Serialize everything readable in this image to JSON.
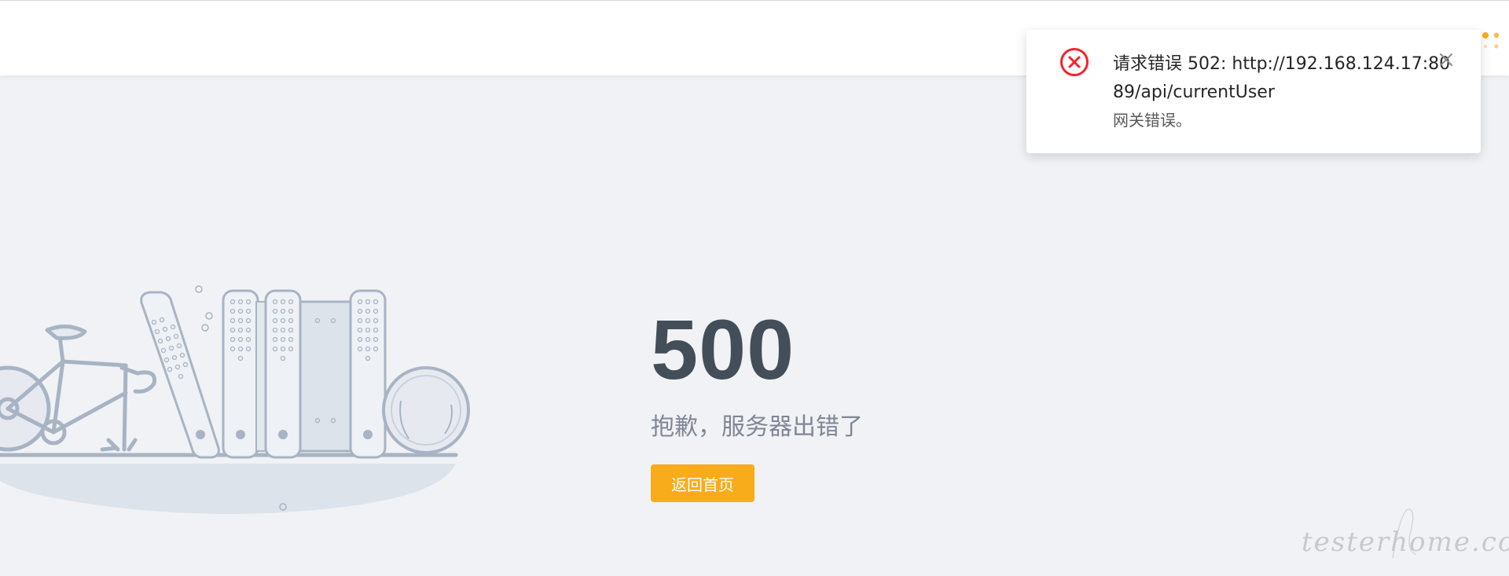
{
  "exception": {
    "code": "500",
    "description": "抱歉，服务器出错了",
    "back_button_label": "返回首页"
  },
  "notification": {
    "title": "请求错误 502: http://192.168.124.17:8089/api/currentUser",
    "description": "网关错误。",
    "icon": "error-circle-icon",
    "close_icon": "close-icon"
  },
  "watermark": {
    "text": "testerhome.com"
  },
  "colors": {
    "page_bg": "#f0f2f5",
    "accent": "#f8ab1b",
    "error": "#f5222d",
    "code_text": "#434e59",
    "illustration_stroke": "#a8b4c4"
  }
}
